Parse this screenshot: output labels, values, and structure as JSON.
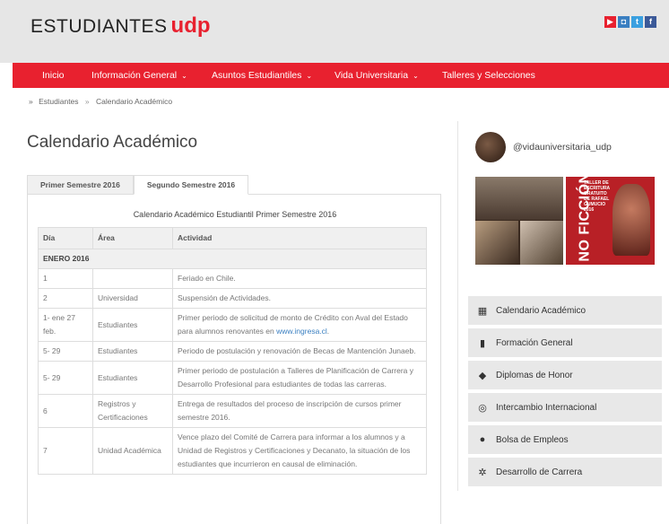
{
  "header": {
    "logo_text": "ESTUDIANTES",
    "logo_brand": "udp",
    "brand_color": "#e8212f"
  },
  "social": [
    {
      "name": "youtube-icon",
      "glyph": "▶",
      "color": "#e8212f"
    },
    {
      "name": "instagram-icon",
      "glyph": "◘",
      "color": "#3a7fc1"
    },
    {
      "name": "twitter-icon",
      "glyph": "t",
      "color": "#3aa0e0"
    },
    {
      "name": "facebook-icon",
      "glyph": "f",
      "color": "#3b5998"
    }
  ],
  "nav": {
    "items": [
      {
        "label": "Inicio",
        "has_dropdown": false
      },
      {
        "label": "Información General",
        "has_dropdown": true
      },
      {
        "label": "Asuntos Estudiantiles",
        "has_dropdown": true
      },
      {
        "label": "Vida Universitaria",
        "has_dropdown": true
      },
      {
        "label": "Talleres y Selecciones",
        "has_dropdown": false
      }
    ]
  },
  "breadcrumb": {
    "prefix": "»",
    "items": [
      "Estudiantes",
      "Calendario Académico"
    ],
    "sep": "»"
  },
  "page": {
    "title": "Calendario Académico"
  },
  "tabs": [
    {
      "label": "Primer Semestre 2016",
      "active": false
    },
    {
      "label": "Segundo Semestre 2016",
      "active": true
    }
  ],
  "calendar": {
    "title": "Calendario Académico Estudiantil Primer Semestre 2016",
    "headers": [
      "Día",
      "Área",
      "Actividad"
    ],
    "month": "ENERO 2016",
    "rows": [
      {
        "dia": "1",
        "area": "",
        "actividad": "Feriado en Chile."
      },
      {
        "dia": "2",
        "area": "Universidad",
        "actividad": "Suspensión de Actividades."
      },
      {
        "dia": "1- ene 27 feb.",
        "area": "Estudiantes",
        "actividad": "Primer periodo de solicitud de monto de Crédito con Aval del Estado para alumnos renovantes en ",
        "link": "www.ingresa.cl",
        "after_link": "."
      },
      {
        "dia": "5- 29",
        "area": "Estudiantes",
        "actividad": "Periodo de postulación y renovación de Becas de Mantención Junaeb."
      },
      {
        "dia": "5- 29",
        "area": "Estudiantes",
        "actividad": "Primer periodo de postulación a Talleres de Planificación de Carrera y Desarrollo Profesional para estudiantes de todas las carreras."
      },
      {
        "dia": "6",
        "area": "Registros y Certificaciones",
        "actividad": "Entrega de resultados del proceso de inscripción de cursos primer semestre 2016."
      },
      {
        "dia": "7",
        "area": "Unidad Académica",
        "actividad": "Vence plazo del Comité de Carrera para informar a los alumnos y a Unidad de Registros y Certificaciones y Decanato, la situación de los estudiantes que incurrieron en causal de eliminación."
      }
    ]
  },
  "sidebar": {
    "profile_handle": "@vidauniversitaria_udp",
    "post2_big_text": "NO FICCIÓN",
    "post2_small_text": "TALLER DE ESCRITURA GRATUITO DE RAFAEL GUMUCIO 2016",
    "menu": [
      {
        "label": "Calendario Académico",
        "icon": "calendar-icon",
        "glyph": "▦"
      },
      {
        "label": "Formación General",
        "icon": "book-icon",
        "glyph": "▮"
      },
      {
        "label": "Diplomas de Honor",
        "icon": "graduation-cap-icon",
        "glyph": "◆"
      },
      {
        "label": "Intercambio Internacional",
        "icon": "globe-icon",
        "glyph": "◎"
      },
      {
        "label": "Bolsa de Empleos",
        "icon": "binoculars-icon",
        "glyph": "●"
      },
      {
        "label": "Desarrollo de Carrera",
        "icon": "gears-icon",
        "glyph": "✲"
      }
    ]
  }
}
